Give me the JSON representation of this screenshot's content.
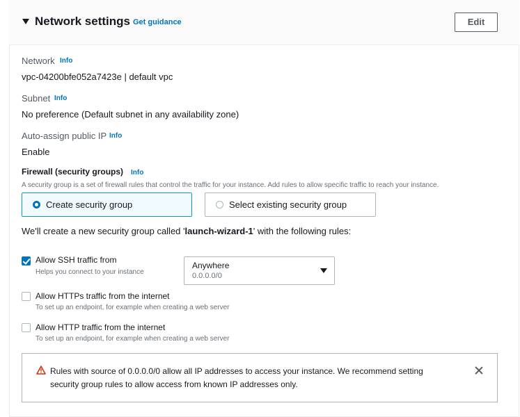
{
  "header": {
    "title": "Network settings",
    "guidance_link": "Get guidance",
    "edit_button": "Edit"
  },
  "network": {
    "label": "Network",
    "info": "Info",
    "value": "vpc-04200bfe052a7423e | default vpc"
  },
  "subnet": {
    "label": "Subnet",
    "info": "Info",
    "value": "No preference (Default subnet in any availability zone)"
  },
  "public_ip": {
    "label": "Auto-assign public IP",
    "info": "Info",
    "value": "Enable"
  },
  "firewall": {
    "title": "Firewall (security groups)",
    "info": "Info",
    "description": "A security group is a set of firewall rules that control the traffic for your instance. Add rules to allow specific traffic to reach your instance.",
    "options": [
      {
        "label": "Create security group",
        "selected": true
      },
      {
        "label": "Select existing security group",
        "selected": false
      }
    ],
    "create_note_prefix": "We'll create a new security group called '",
    "group_name": "launch-wizard-1",
    "create_note_suffix": "' with the following rules:"
  },
  "rules": [
    {
      "label": "Allow SSH traffic from",
      "description": "Helps you connect to your instance",
      "checked": true
    },
    {
      "label": "Allow HTTPs traffic from the internet",
      "description": "To set up an endpoint, for example when creating a web server",
      "checked": false
    },
    {
      "label": "Allow HTTP traffic from the internet",
      "description": "To set up an endpoint, for example when creating a web server",
      "checked": false
    }
  ],
  "ssh_source": {
    "selected": "Anywhere",
    "detail": "0.0.0.0/0"
  },
  "alert": {
    "text": "Rules with source of 0.0.0.0/0 allow all IP addresses to access your instance. We recommend setting security group rules to allow access from known IP addresses only."
  },
  "colors": {
    "link": "#0073bb",
    "accent_border": "#00a1c9",
    "warning": "#d13212"
  }
}
